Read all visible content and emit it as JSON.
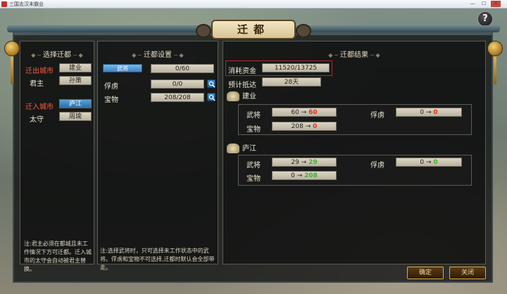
{
  "window": {
    "title": "三国志汉末霸业"
  },
  "dialog": {
    "title": "迁都"
  },
  "help": "?",
  "left": {
    "header": "选择迁都",
    "from_city_label": "迁出城市",
    "from_city_value": "建业",
    "lord_label": "君主",
    "lord_value": "孙策",
    "to_city_label": "迁入城市",
    "to_city_value": "庐江",
    "governor_label": "太守",
    "governor_value": "周瑜",
    "note": "注:君主必须在都城且未工作情况下方可迁都。迁入城市的太守会自动被君主替换。"
  },
  "mid": {
    "header": "迁都设置",
    "generals_btn": "武将",
    "generals_value": "0/60",
    "captives_label": "俘虏",
    "captives_value": "0/0",
    "treasures_label": "宝物",
    "treasures_value": "208/208",
    "note": "注:选择武将时，只可选择未工作状态中的武将。俘虏和宝物不可选择,迁都时默认会全部带走。"
  },
  "right": {
    "header": "迁都结果",
    "cost_label": "消耗资金",
    "cost_value": "11520/13725",
    "eta_label": "预计抵达",
    "eta_value": "28天",
    "cities": [
      {
        "name": "建业",
        "generals_label": "武将",
        "generals_from": "60",
        "generals_to": "60",
        "generals_color": "#e0301e",
        "captives_label": "俘虏",
        "captives_from": "0",
        "captives_to": "0",
        "captives_color": "#e0301e",
        "treasures_label": "宝物",
        "treasures_from": "208",
        "treasures_to": "0",
        "treasures_color": "#e0301e"
      },
      {
        "name": "庐江",
        "generals_label": "武将",
        "generals_from": "29",
        "generals_to": "29",
        "generals_color": "#3fb02e",
        "captives_label": "俘虏",
        "captives_from": "0",
        "captives_to": "0",
        "captives_color": "#3fb02e",
        "treasures_label": "宝物",
        "treasures_from": "0",
        "treasures_to": "208",
        "treasures_color": "#3fb02e"
      }
    ],
    "arrow": "→"
  },
  "buttons": {
    "confirm": "确定",
    "close": "关闭"
  }
}
